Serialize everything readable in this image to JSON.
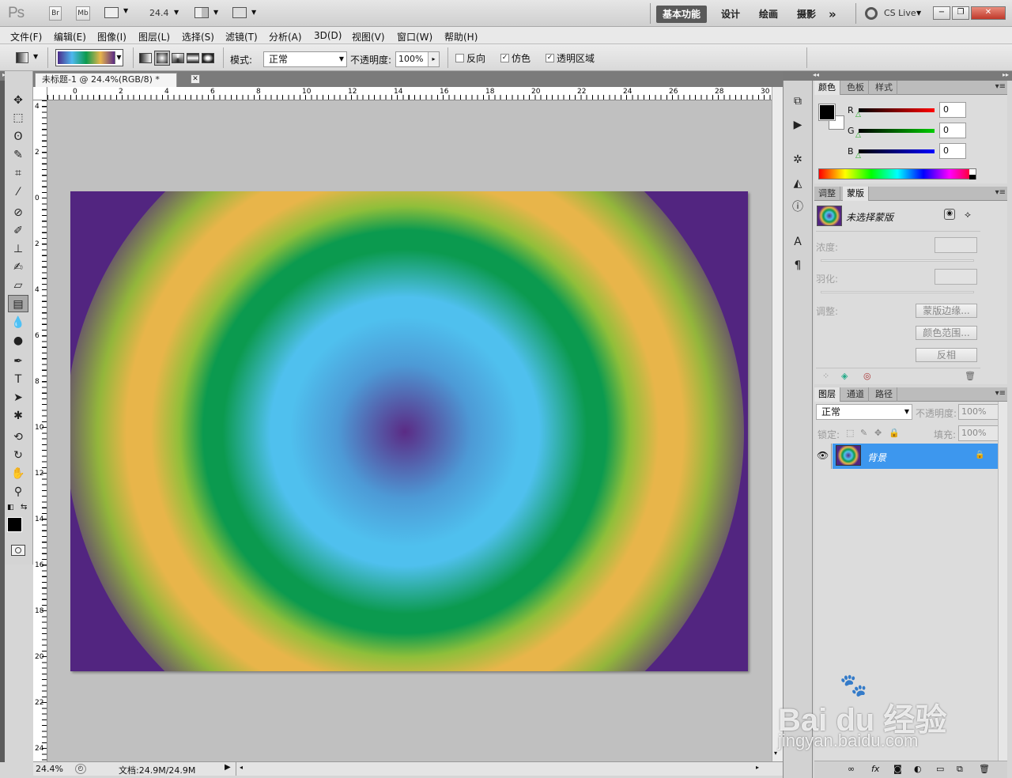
{
  "app": {
    "logo": "Ps",
    "bridge_label": "Br",
    "minibridge_label": "Mb",
    "zoom_display": "24.4",
    "workspaces": [
      "基本功能",
      "设计",
      "绘画",
      "摄影"
    ],
    "overflow": "»",
    "cs_live": "CS Live"
  },
  "menu": [
    "文件(F)",
    "编辑(E)",
    "图像(I)",
    "图层(L)",
    "选择(S)",
    "滤镜(T)",
    "分析(A)",
    "3D(D)",
    "视图(V)",
    "窗口(W)",
    "帮助(H)"
  ],
  "options": {
    "mode_label": "模式:",
    "mode_value": "正常",
    "opacity_label": "不透明度:",
    "opacity_value": "100%",
    "reverse_label": "反向",
    "reverse_checked": false,
    "dither_label": "仿色",
    "dither_checked": true,
    "transparency_label": "透明区域",
    "transparency_checked": true
  },
  "document": {
    "tab_title": "未标题-1 @ 24.4%(RGB/8) *",
    "ruler_h": [
      "0",
      "2",
      "4",
      "6",
      "8",
      "10",
      "12",
      "14",
      "16",
      "18",
      "20",
      "22",
      "24",
      "26",
      "28",
      "30"
    ],
    "ruler_v": [
      "4",
      "2",
      "0",
      "2",
      "4",
      "6",
      "8",
      "10",
      "12",
      "14",
      "16",
      "18",
      "20",
      "22",
      "24"
    ],
    "status_zoom": "24.4%",
    "status_doc": "文档:24.9M/24.9M"
  },
  "color_panel": {
    "tabs": [
      "颜色",
      "色板",
      "样式"
    ],
    "r_label": "R",
    "g_label": "G",
    "b_label": "B",
    "r_value": "0",
    "g_value": "0",
    "b_value": "0"
  },
  "masks_panel": {
    "tabs": [
      "调整",
      "蒙版"
    ],
    "title": "未选择蒙版",
    "density_label": "浓度:",
    "feather_label": "羽化:",
    "refine_label": "调整:",
    "mask_edge_btn": "蒙版边缘...",
    "color_range_btn": "颜色范围...",
    "invert_btn": "反相"
  },
  "layers_panel": {
    "tabs": [
      "图层",
      "通道",
      "路径"
    ],
    "blend_mode": "正常",
    "opacity_label": "不透明度:",
    "opacity_value": "100%",
    "lock_label": "锁定:",
    "fill_label": "填充:",
    "fill_value": "100%",
    "layer_name": "背景"
  },
  "watermark": {
    "brand": "Bai du 经验",
    "url": "jingyan.baidu.com"
  }
}
